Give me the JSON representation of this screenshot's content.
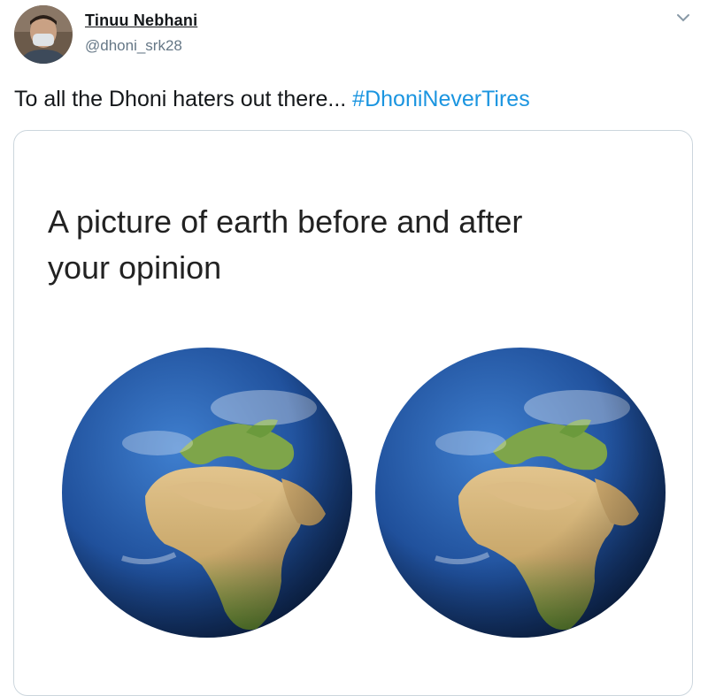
{
  "tweet": {
    "author": {
      "display_name": "Tinuu Nebhani",
      "handle": "@dhoni_srk28",
      "avatar_icon": "user-avatar-masked"
    },
    "menu_icon": "chevron-down-icon",
    "text": "To all the Dhoni haters out there... ",
    "hashtag": "#DhoniNeverTires"
  },
  "media": {
    "caption_line1": "A picture of earth before and after",
    "caption_line2": "your opinion",
    "images": [
      "earth-globe-before",
      "earth-globe-after"
    ]
  },
  "colors": {
    "hashtag": "#1b95e0",
    "handle": "#657786",
    "border": "#ccd6dd",
    "ocean": "#1f4f9a",
    "land_green": "#6f9e3a",
    "land_desert": "#d6b57a"
  }
}
